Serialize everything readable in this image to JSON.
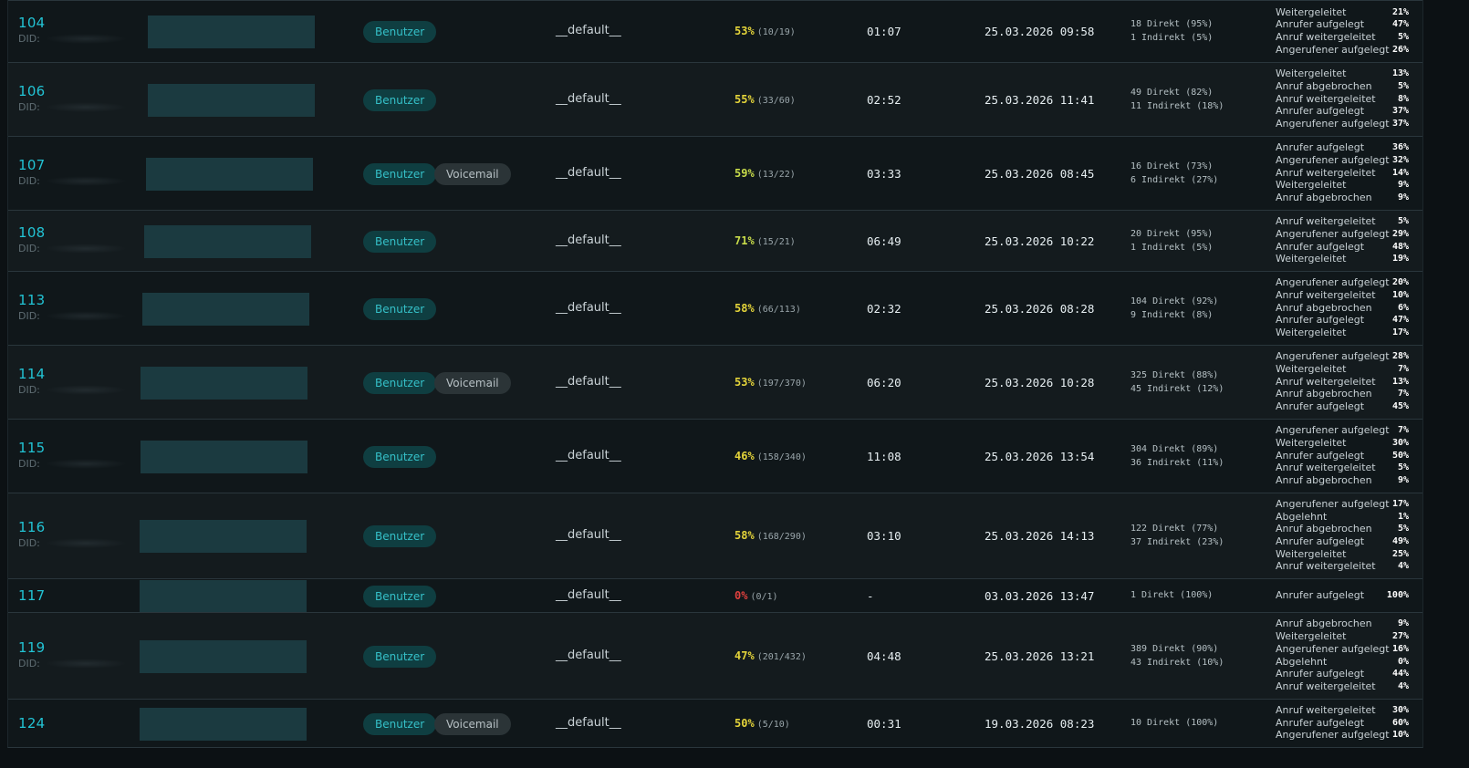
{
  "colors": {
    "accent": "#22c3d4",
    "rate_yellow": "#e4d43a",
    "rate_lightgreen": "#c8dc4a",
    "rate_red": "#e0403e"
  },
  "rows": [
    {
      "ext": "104",
      "did": "DID:",
      "badges": [
        "Benutzer"
      ],
      "profile": "__default__",
      "pct": "53%",
      "cnt": "(10/19)",
      "color": "#e4d43a",
      "duration": "01:07",
      "last": "25.03.2026 09:58",
      "dist": [
        "18 Direkt (95%)",
        "1 Indirekt (5%)"
      ],
      "reasons": [
        [
          "Weitergeleitet",
          "21%"
        ],
        [
          "Anrufer aufgelegt",
          "47%"
        ],
        [
          "Anruf weitergeleitet",
          "5%"
        ],
        [
          "Angerufener aufgelegt",
          "26%"
        ]
      ]
    },
    {
      "ext": "106",
      "did": "DID:",
      "badges": [
        "Benutzer"
      ],
      "profile": "__default__",
      "pct": "55%",
      "cnt": "(33/60)",
      "color": "#e4d43a",
      "duration": "02:52",
      "last": "25.03.2026 11:41",
      "dist": [
        "49 Direkt (82%)",
        "11 Indirekt (18%)"
      ],
      "reasons": [
        [
          "Weitergeleitet",
          "13%"
        ],
        [
          "Anruf abgebrochen",
          "5%"
        ],
        [
          "Anruf weitergeleitet",
          "8%"
        ],
        [
          "Anrufer aufgelegt",
          "37%"
        ],
        [
          "Angerufener aufgelegt",
          "37%"
        ]
      ]
    },
    {
      "ext": "107",
      "did": "DID:",
      "badges": [
        "Benutzer",
        "Voicemail"
      ],
      "profile": "__default__",
      "pct": "59%",
      "cnt": "(13/22)",
      "color": "#c8dc4a",
      "duration": "03:33",
      "last": "25.03.2026 08:45",
      "dist": [
        "16 Direkt (73%)",
        "6 Indirekt (27%)"
      ],
      "reasons": [
        [
          "Anrufer aufgelegt",
          "36%"
        ],
        [
          "Angerufener aufgelegt",
          "32%"
        ],
        [
          "Anruf weitergeleitet",
          "14%"
        ],
        [
          "Weitergeleitet",
          "9%"
        ],
        [
          "Anruf abgebrochen",
          "9%"
        ]
      ]
    },
    {
      "ext": "108",
      "did": "DID:",
      "badges": [
        "Benutzer"
      ],
      "profile": "__default__",
      "pct": "71%",
      "cnt": "(15/21)",
      "color": "#c8dc4a",
      "duration": "06:49",
      "last": "25.03.2026 10:22",
      "dist": [
        "20 Direkt (95%)",
        "1 Indirekt (5%)"
      ],
      "reasons": [
        [
          "Anruf weitergeleitet",
          "5%"
        ],
        [
          "Angerufener aufgelegt",
          "29%"
        ],
        [
          "Anrufer aufgelegt",
          "48%"
        ],
        [
          "Weitergeleitet",
          "19%"
        ]
      ]
    },
    {
      "ext": "113",
      "did": "DID:",
      "badges": [
        "Benutzer"
      ],
      "profile": "__default__",
      "pct": "58%",
      "cnt": "(66/113)",
      "color": "#e4d43a",
      "duration": "02:32",
      "last": "25.03.2026 08:28",
      "dist": [
        "104 Direkt (92%)",
        "9 Indirekt (8%)"
      ],
      "reasons": [
        [
          "Angerufener aufgelegt",
          "20%"
        ],
        [
          "Anruf weitergeleitet",
          "10%"
        ],
        [
          "Anruf abgebrochen",
          "6%"
        ],
        [
          "Anrufer aufgelegt",
          "47%"
        ],
        [
          "Weitergeleitet",
          "17%"
        ]
      ]
    },
    {
      "ext": "114",
      "did": "DID:",
      "badges": [
        "Benutzer",
        "Voicemail"
      ],
      "profile": "__default__",
      "pct": "53%",
      "cnt": "(197/370)",
      "color": "#e4d43a",
      "duration": "06:20",
      "last": "25.03.2026 10:28",
      "dist": [
        "325 Direkt (88%)",
        "45 Indirekt (12%)"
      ],
      "reasons": [
        [
          "Angerufener aufgelegt",
          "28%"
        ],
        [
          "Weitergeleitet",
          "7%"
        ],
        [
          "Anruf weitergeleitet",
          "13%"
        ],
        [
          "Anruf abgebrochen",
          "7%"
        ],
        [
          "Anrufer aufgelegt",
          "45%"
        ]
      ]
    },
    {
      "ext": "115",
      "did": "DID:",
      "badges": [
        "Benutzer"
      ],
      "profile": "__default__",
      "pct": "46%",
      "cnt": "(158/340)",
      "color": "#e4d43a",
      "duration": "11:08",
      "last": "25.03.2026 13:54",
      "dist": [
        "304 Direkt (89%)",
        "36 Indirekt (11%)"
      ],
      "reasons": [
        [
          "Angerufener aufgelegt",
          "7%"
        ],
        [
          "Weitergeleitet",
          "30%"
        ],
        [
          "Anrufer aufgelegt",
          "50%"
        ],
        [
          "Anruf weitergeleitet",
          "5%"
        ],
        [
          "Anruf abgebrochen",
          "9%"
        ]
      ]
    },
    {
      "ext": "116",
      "did": "DID:",
      "badges": [
        "Benutzer"
      ],
      "profile": "__default__",
      "pct": "58%",
      "cnt": "(168/290)",
      "color": "#e4d43a",
      "duration": "03:10",
      "last": "25.03.2026 14:13",
      "dist": [
        "122 Direkt (77%)",
        "37 Indirekt (23%)"
      ],
      "reasons": [
        [
          "Angerufener aufgelegt",
          "17%"
        ],
        [
          "Abgelehnt",
          "1%"
        ],
        [
          "Anruf abgebrochen",
          "5%"
        ],
        [
          "Anrufer aufgelegt",
          "49%"
        ],
        [
          "Weitergeleitet",
          "25%"
        ],
        [
          "Anruf weitergeleitet",
          "4%"
        ]
      ]
    },
    {
      "ext": "117",
      "did": "",
      "badges": [
        "Benutzer"
      ],
      "profile": "__default__",
      "pct": "0%",
      "cnt": "(0/1)",
      "color": "#e0403e",
      "duration": "-",
      "last": "03.03.2026 13:47",
      "dist": [
        "1 Direkt (100%)"
      ],
      "reasons": [
        [
          "Anrufer aufgelegt",
          "100%"
        ]
      ]
    },
    {
      "ext": "119",
      "did": "DID:",
      "badges": [
        "Benutzer"
      ],
      "profile": "__default__",
      "pct": "47%",
      "cnt": "(201/432)",
      "color": "#e4d43a",
      "duration": "04:48",
      "last": "25.03.2026 13:21",
      "dist": [
        "389 Direkt (90%)",
        "43 Indirekt (10%)"
      ],
      "reasons": [
        [
          "Anruf abgebrochen",
          "9%"
        ],
        [
          "Weitergeleitet",
          "27%"
        ],
        [
          "Angerufener aufgelegt",
          "16%"
        ],
        [
          "Abgelehnt",
          "0%"
        ],
        [
          "Anrufer aufgelegt",
          "44%"
        ],
        [
          "Anruf weitergeleitet",
          "4%"
        ]
      ]
    },
    {
      "ext": "124",
      "did": "",
      "badges": [
        "Benutzer",
        "Voicemail"
      ],
      "profile": "__default__",
      "pct": "50%",
      "cnt": "(5/10)",
      "color": "#e4d43a",
      "duration": "00:31",
      "last": "19.03.2026 08:23",
      "dist": [
        "10 Direkt (100%)"
      ],
      "reasons": [
        [
          "Anruf weitergeleitet",
          "30%"
        ],
        [
          "Anrufer aufgelegt",
          "60%"
        ],
        [
          "Angerufener aufgelegt",
          "10%"
        ]
      ]
    }
  ]
}
